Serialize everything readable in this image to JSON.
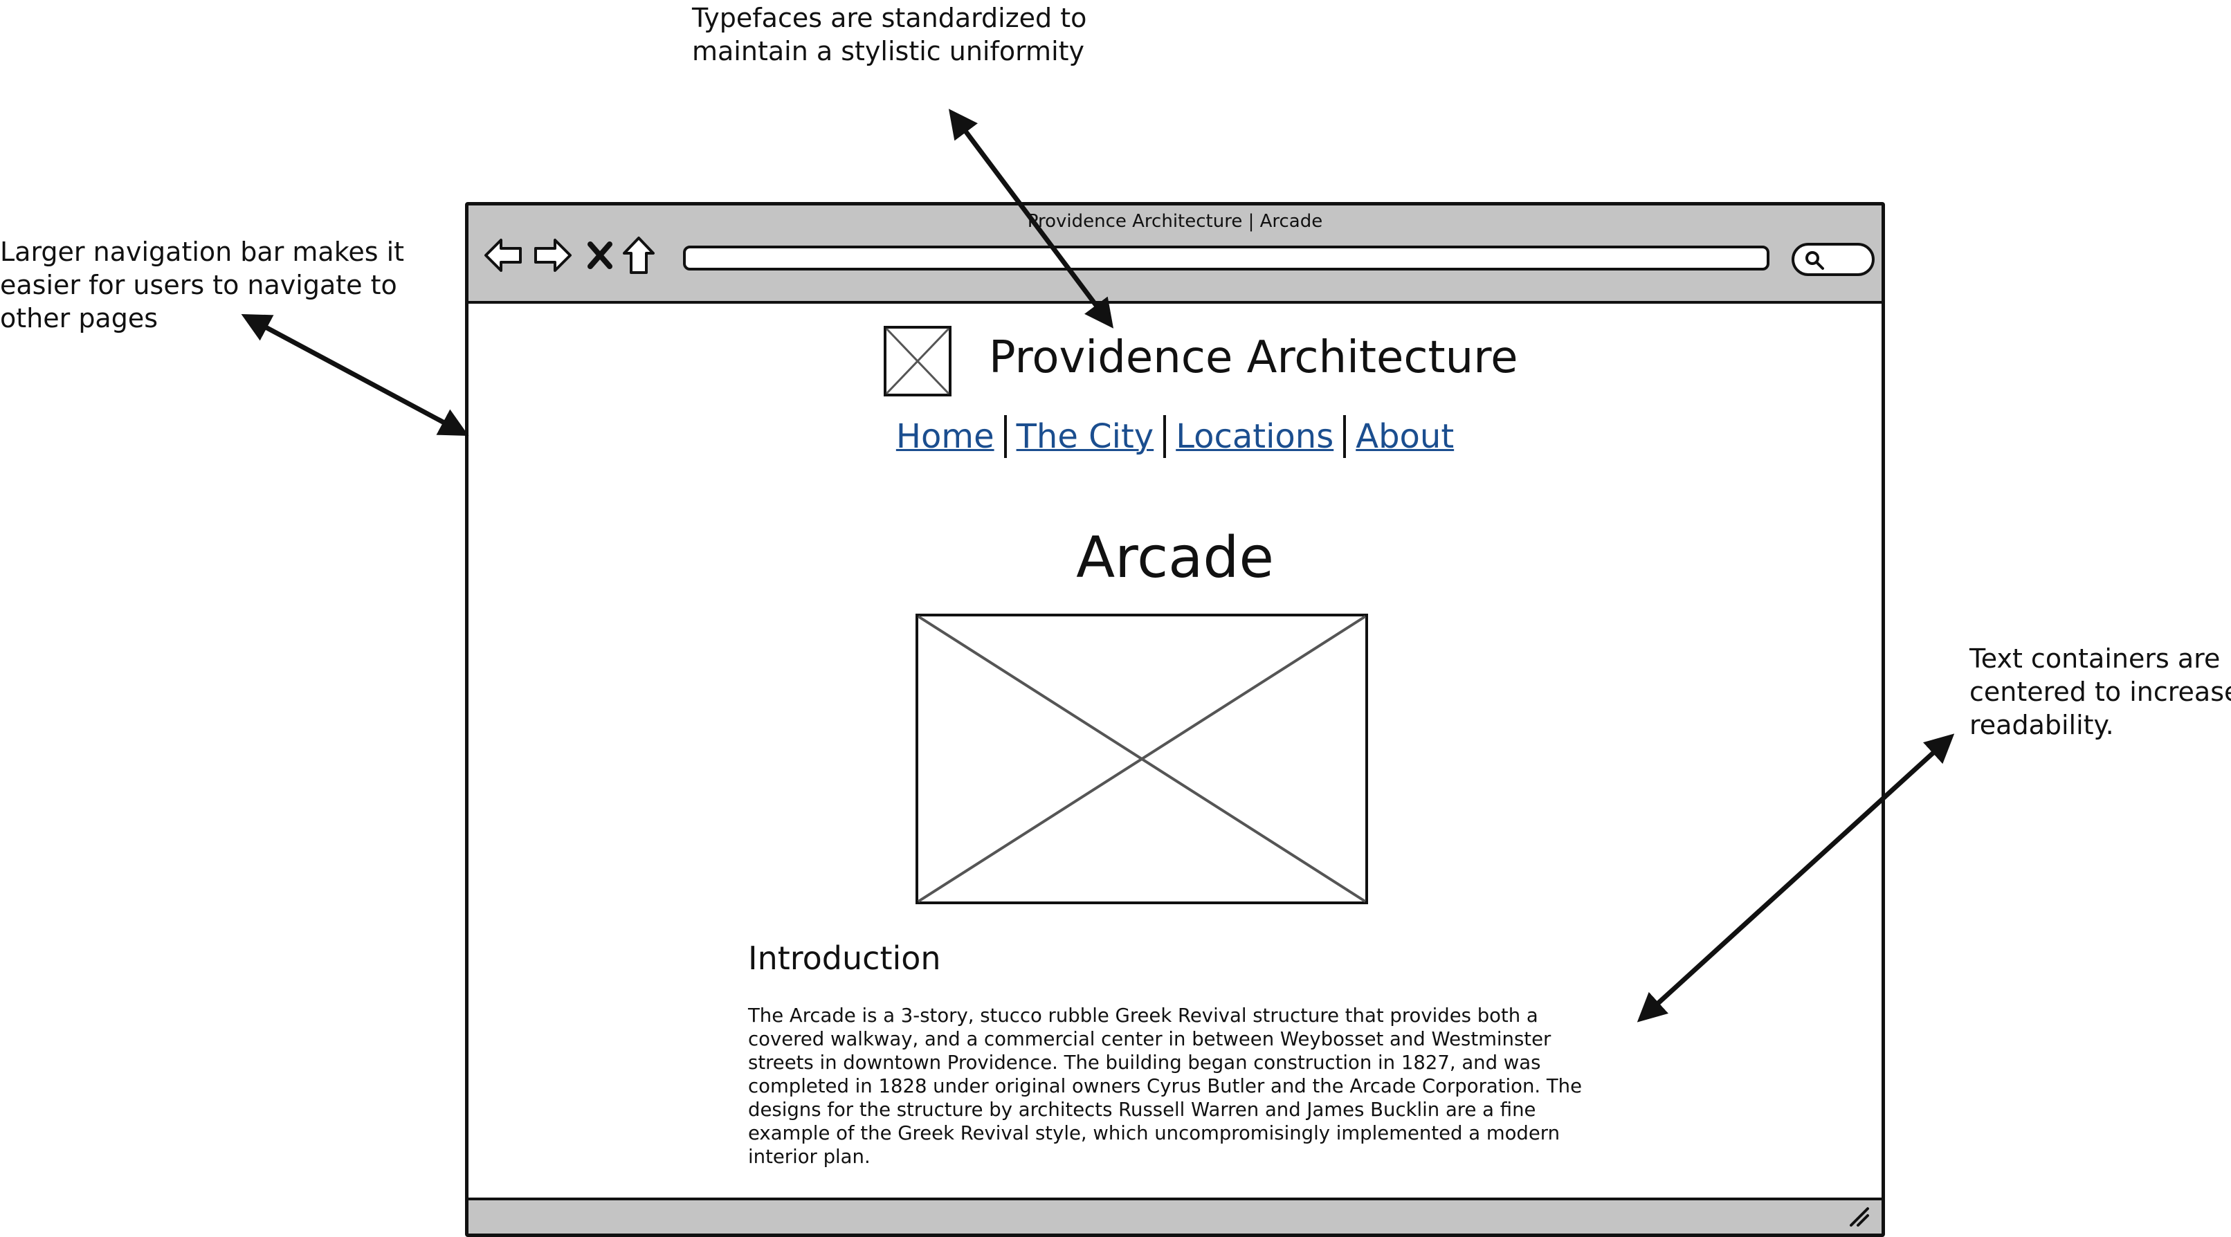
{
  "annotations": {
    "typefaces": "Typefaces are standardized to\nmaintain a stylistic uniformity",
    "nav": "Larger navigation bar makes it\neasier for users to navigate to\nother pages",
    "text": "Text containers are\ncentered to increase\nreadability."
  },
  "browser": {
    "window_title": "Providence Architecture | Arcade",
    "toolbar_icons": [
      "back-arrow-icon",
      "forward-arrow-icon",
      "close-x-icon",
      "home-icon"
    ],
    "address_value": "",
    "search_icon": "search-icon",
    "resize_icon": "resize-grip-icon"
  },
  "site": {
    "logo_icon": "image-placeholder-icon",
    "title": "Providence Architecture",
    "nav": [
      "Home",
      "The City",
      "Locations",
      "About"
    ]
  },
  "page": {
    "heading": "Arcade",
    "image_icon": "image-placeholder-icon",
    "section_title": "Introduction",
    "section_body": "The Arcade is a 3-story, stucco rubble Greek Revival structure that provides both a covered walkway, and a commercial center in between Weybosset and Westminster streets in downtown Providence. The building began construction in 1827, and was completed in 1828 under original owners Cyrus Butler and the Arcade Corporation. The designs for the structure by architects Russell Warren and James Bucklin are a fine example of the Greek Revival style, which uncompromisingly implemented a modern interior plan."
  },
  "colors": {
    "chrome": "#c4c4c4",
    "link": "#1b4e8f",
    "placeholder_lines": "#555555"
  }
}
